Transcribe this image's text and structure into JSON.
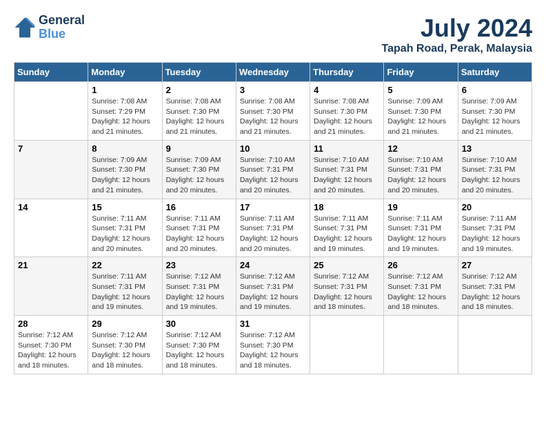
{
  "header": {
    "logo_line1": "General",
    "logo_line2": "Blue",
    "month_year": "July 2024",
    "location": "Tapah Road, Perak, Malaysia"
  },
  "days_of_week": [
    "Sunday",
    "Monday",
    "Tuesday",
    "Wednesday",
    "Thursday",
    "Friday",
    "Saturday"
  ],
  "weeks": [
    [
      {
        "day": "",
        "info": ""
      },
      {
        "day": "1",
        "info": "Sunrise: 7:08 AM\nSunset: 7:29 PM\nDaylight: 12 hours and 21 minutes."
      },
      {
        "day": "2",
        "info": "Sunrise: 7:08 AM\nSunset: 7:30 PM\nDaylight: 12 hours and 21 minutes."
      },
      {
        "day": "3",
        "info": "Sunrise: 7:08 AM\nSunset: 7:30 PM\nDaylight: 12 hours and 21 minutes."
      },
      {
        "day": "4",
        "info": "Sunrise: 7:08 AM\nSunset: 7:30 PM\nDaylight: 12 hours and 21 minutes."
      },
      {
        "day": "5",
        "info": "Sunrise: 7:09 AM\nSunset: 7:30 PM\nDaylight: 12 hours and 21 minutes."
      },
      {
        "day": "6",
        "info": "Sunrise: 7:09 AM\nSunset: 7:30 PM\nDaylight: 12 hours and 21 minutes."
      }
    ],
    [
      {
        "day": "7",
        "info": ""
      },
      {
        "day": "8",
        "info": "Sunrise: 7:09 AM\nSunset: 7:30 PM\nDaylight: 12 hours and 21 minutes."
      },
      {
        "day": "9",
        "info": "Sunrise: 7:09 AM\nSunset: 7:30 PM\nDaylight: 12 hours and 20 minutes."
      },
      {
        "day": "10",
        "info": "Sunrise: 7:10 AM\nSunset: 7:31 PM\nDaylight: 12 hours and 20 minutes."
      },
      {
        "day": "11",
        "info": "Sunrise: 7:10 AM\nSunset: 7:31 PM\nDaylight: 12 hours and 20 minutes."
      },
      {
        "day": "12",
        "info": "Sunrise: 7:10 AM\nSunset: 7:31 PM\nDaylight: 12 hours and 20 minutes."
      },
      {
        "day": "13",
        "info": "Sunrise: 7:10 AM\nSunset: 7:31 PM\nDaylight: 12 hours and 20 minutes."
      }
    ],
    [
      {
        "day": "14",
        "info": ""
      },
      {
        "day": "15",
        "info": "Sunrise: 7:11 AM\nSunset: 7:31 PM\nDaylight: 12 hours and 20 minutes."
      },
      {
        "day": "16",
        "info": "Sunrise: 7:11 AM\nSunset: 7:31 PM\nDaylight: 12 hours and 20 minutes."
      },
      {
        "day": "17",
        "info": "Sunrise: 7:11 AM\nSunset: 7:31 PM\nDaylight: 12 hours and 20 minutes."
      },
      {
        "day": "18",
        "info": "Sunrise: 7:11 AM\nSunset: 7:31 PM\nDaylight: 12 hours and 19 minutes."
      },
      {
        "day": "19",
        "info": "Sunrise: 7:11 AM\nSunset: 7:31 PM\nDaylight: 12 hours and 19 minutes."
      },
      {
        "day": "20",
        "info": "Sunrise: 7:11 AM\nSunset: 7:31 PM\nDaylight: 12 hours and 19 minutes."
      }
    ],
    [
      {
        "day": "21",
        "info": ""
      },
      {
        "day": "22",
        "info": "Sunrise: 7:11 AM\nSunset: 7:31 PM\nDaylight: 12 hours and 19 minutes."
      },
      {
        "day": "23",
        "info": "Sunrise: 7:12 AM\nSunset: 7:31 PM\nDaylight: 12 hours and 19 minutes."
      },
      {
        "day": "24",
        "info": "Sunrise: 7:12 AM\nSunset: 7:31 PM\nDaylight: 12 hours and 19 minutes."
      },
      {
        "day": "25",
        "info": "Sunrise: 7:12 AM\nSunset: 7:31 PM\nDaylight: 12 hours and 18 minutes."
      },
      {
        "day": "26",
        "info": "Sunrise: 7:12 AM\nSunset: 7:31 PM\nDaylight: 12 hours and 18 minutes."
      },
      {
        "day": "27",
        "info": "Sunrise: 7:12 AM\nSunset: 7:31 PM\nDaylight: 12 hours and 18 minutes."
      }
    ],
    [
      {
        "day": "28",
        "info": "Sunrise: 7:12 AM\nSunset: 7:30 PM\nDaylight: 12 hours and 18 minutes."
      },
      {
        "day": "29",
        "info": "Sunrise: 7:12 AM\nSunset: 7:30 PM\nDaylight: 12 hours and 18 minutes."
      },
      {
        "day": "30",
        "info": "Sunrise: 7:12 AM\nSunset: 7:30 PM\nDaylight: 12 hours and 18 minutes."
      },
      {
        "day": "31",
        "info": "Sunrise: 7:12 AM\nSunset: 7:30 PM\nDaylight: 12 hours and 18 minutes."
      },
      {
        "day": "",
        "info": ""
      },
      {
        "day": "",
        "info": ""
      },
      {
        "day": "",
        "info": ""
      }
    ]
  ]
}
